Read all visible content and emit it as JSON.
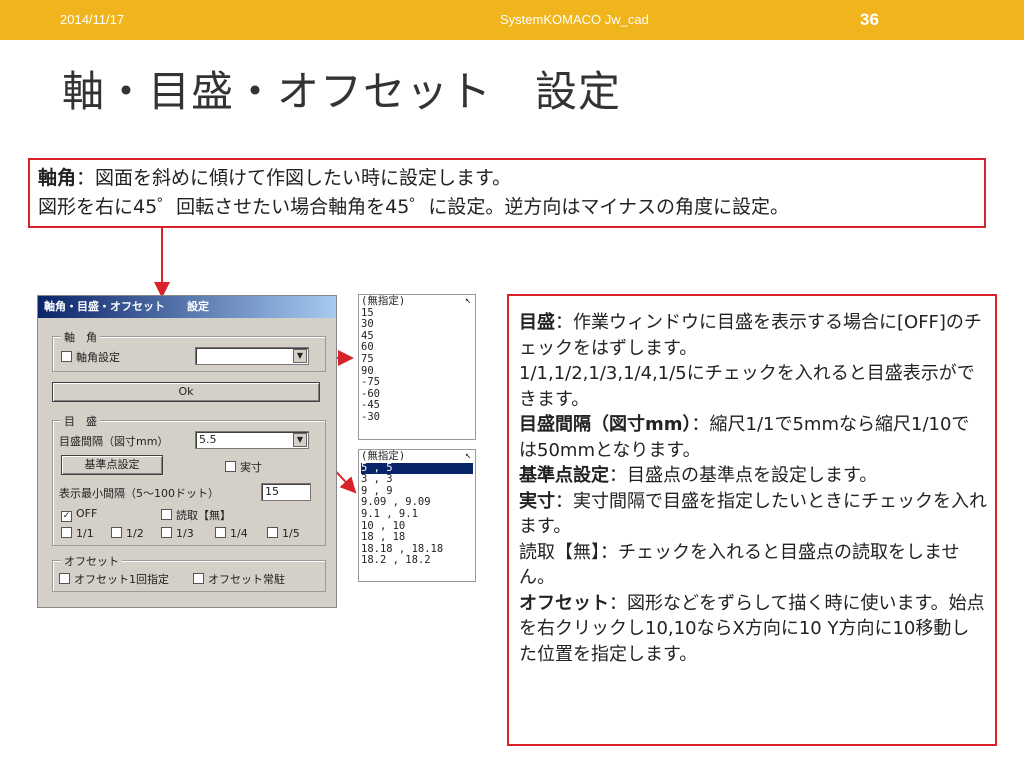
{
  "header": {
    "date": "2014/11/17",
    "footer_title": "SystemKOMACO Jw_cad",
    "page_number": "36",
    "bar_color": "#f0b41c"
  },
  "title": "軸・目盛・オフセット　設定",
  "axis_note": {
    "term": "軸角",
    "line1_rest": "：図面を斜めに傾けて作図したい時に設定します。",
    "line2": "図形を右に45゜回転させたい場合軸角を45゜に設定。逆方向はマイナスの角度に設定。"
  },
  "dialog": {
    "caption": "軸角・目盛・オフセット　　設定",
    "axis_group": "軸　角",
    "axis_setting": "軸角設定",
    "ok": "Ok",
    "scale_group": "目　盛",
    "scale_interval_label": "目盛間隔（図寸mm）",
    "scale_interval_value": "5.5",
    "base_point_button": "基準点設定",
    "actual_label": "実寸",
    "min_interval_label": "表示最小間隔（5～100ドット）",
    "min_interval_value": "15",
    "off_label": "OFF",
    "read_label": "読取【無】",
    "ratios": [
      "1/1",
      "1/2",
      "1/3",
      "1/4",
      "1/5"
    ],
    "offset_group": "オフセット",
    "offset_once": "オフセット1回指定",
    "offset_always": "オフセット常駐"
  },
  "angle_list": [
    "(無指定)",
    "15",
    "30",
    "45",
    "60",
    "75",
    "90",
    "-75",
    "-60",
    "-45",
    "-30"
  ],
  "scale_list": [
    "(無指定)",
    "5 , 5",
    "3 , 3",
    "9 , 9",
    "9.09 , 9.09",
    "9.1 , 9.1",
    "10 , 10",
    "18 , 18",
    "18.18 , 18.18",
    "18.2 , 18.2"
  ],
  "notes": {
    "scale_term": "目盛",
    "scale_text": "：作業ウィンドウに目盛を表示する場合に[OFF]のチェックをはずします。",
    "scale_text2": "1/1,1/2,1/3,1/4,1/5にチェックを入れると目盛表示ができます。",
    "interval_term": "目盛間隔（図寸mm）",
    "interval_text": "：縮尺1/1で5mmなら縮尺1/10では50mmとなります。",
    "base_term": "基準点設定",
    "base_text": "：目盛点の基準点を設定します。",
    "actual_term": "実寸",
    "actual_text": "：実寸間隔で目盛を指定したいときにチェックを入れます。",
    "read_text": "読取【無】：チェックを入れると目盛点の読取をしません。",
    "offset_term": "オフセット",
    "offset_text": "：図形などをずらして描く時に使います。始点を右クリックし10,10ならX方向に10 Y方向に10移動した位置を指定します。"
  }
}
